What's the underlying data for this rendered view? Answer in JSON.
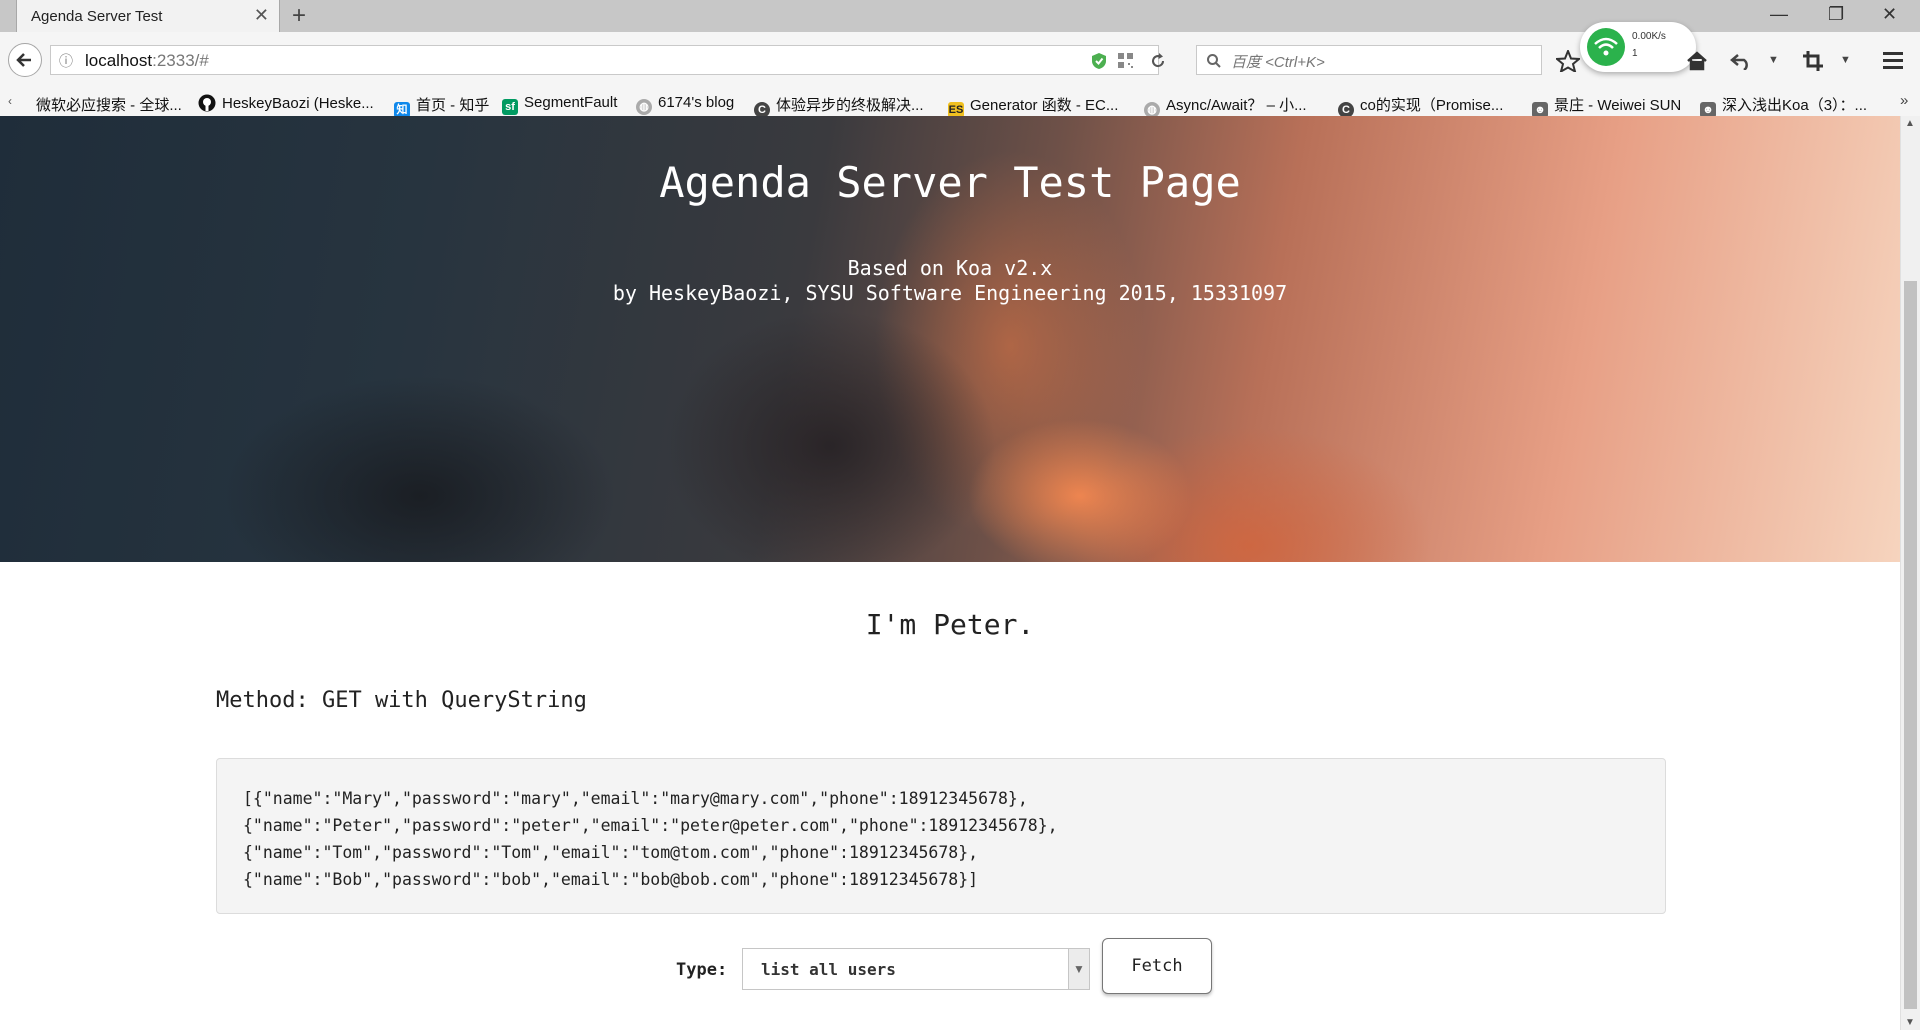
{
  "browser": {
    "tab_title": "Agenda Server Test",
    "url_host": "localhost",
    "url_rest": ":2333/#",
    "search_placeholder": "百度 <Ctrl+K>",
    "net_speed": "0.00K/s",
    "net_count": "1"
  },
  "bookmarks": [
    {
      "label": "微软必应搜索 - 全球...",
      "icon": "none"
    },
    {
      "label": "HeskeyBaozi (Heske...",
      "icon": "github-icon"
    },
    {
      "label": "首页 - 知乎",
      "icon": "zhihu-icon"
    },
    {
      "label": "SegmentFault",
      "icon": "segmentfault-icon"
    },
    {
      "label": "6174's blog",
      "icon": "globe-icon"
    },
    {
      "label": "体验异步的终极解决...",
      "icon": "c-icon"
    },
    {
      "label": "Generator 函数 - EC...",
      "icon": "es-icon"
    },
    {
      "label": "Async/Await？ – 小...",
      "icon": "globe-icon"
    },
    {
      "label": "co的实现（Promise...",
      "icon": "c-icon"
    },
    {
      "label": "景庄 - Weiwei SUN",
      "icon": "avatar-icon"
    },
    {
      "label": "深入浅出Koa（3）：...",
      "icon": "avatar-icon"
    }
  ],
  "hero": {
    "title": "Agenda Server Test Page",
    "line1": "Based on Koa v2.x",
    "line2": "by HeskeyBaozi, SYSU Software Engineering 2015, 15331097"
  },
  "greeting": "I'm Peter.",
  "method": "Method: GET with QueryString",
  "result_lines": [
    "[{\"name\":\"Mary\",\"password\":\"mary\",\"email\":\"mary@mary.com\",\"phone\":18912345678},",
    "{\"name\":\"Peter\",\"password\":\"peter\",\"email\":\"peter@peter.com\",\"phone\":18912345678},",
    "{\"name\":\"Tom\",\"password\":\"Tom\",\"email\":\"tom@tom.com\",\"phone\":18912345678},",
    "{\"name\":\"Bob\",\"password\":\"bob\",\"email\":\"bob@bob.com\",\"phone\":18912345678}]"
  ],
  "form": {
    "type_label": "Type:",
    "type_value": "list all users",
    "fetch_label": "Fetch"
  }
}
